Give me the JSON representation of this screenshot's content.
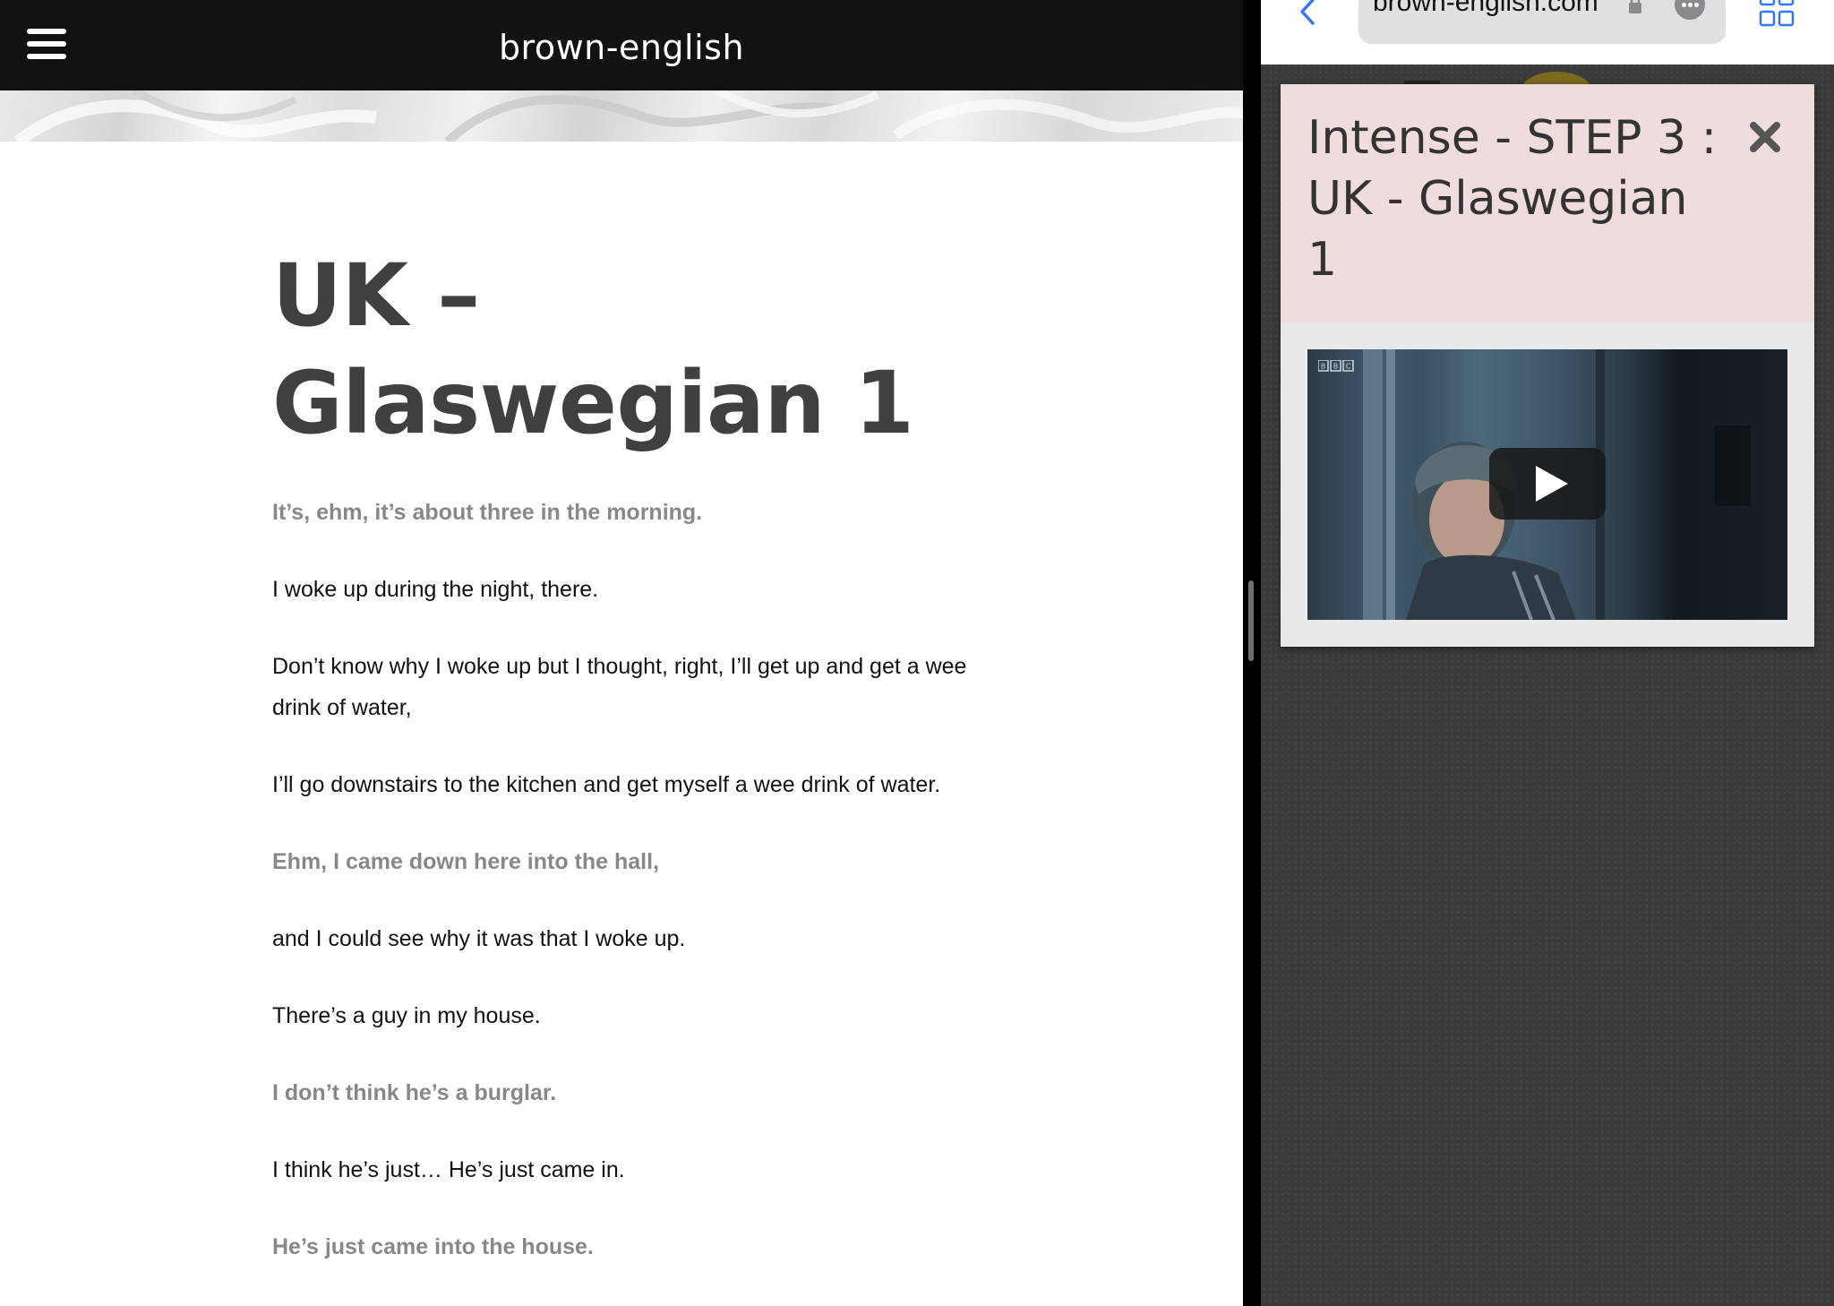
{
  "site": {
    "title": "brown-english"
  },
  "article": {
    "title": "UK – Glaswegian 1",
    "lines": [
      {
        "text": "It’s, ehm, it’s about three in the morning.",
        "style": "muted"
      },
      {
        "text": "I woke up during the night, there.",
        "style": "normal"
      },
      {
        "text": "Don’t know why I woke up but I thought, right, I’ll get up and get a wee drink of water,",
        "style": "normal"
      },
      {
        "text": "I’ll go downstairs to the kitchen and get myself a wee drink of water.",
        "style": "normal"
      },
      {
        "text": "Ehm, I came down here into the hall,",
        "style": "muted"
      },
      {
        "text": "and I could see why it was that I woke up.",
        "style": "normal"
      },
      {
        "text": "There’s a guy in my house.",
        "style": "normal"
      },
      {
        "text": "I don’t think he’s a burglar.",
        "style": "muted"
      },
      {
        "text": "I think he’s just… He’s just came in.",
        "style": "normal"
      },
      {
        "text": "He’s just came into the house.",
        "style": "muted"
      }
    ]
  },
  "browser": {
    "url": "brown-english.com",
    "icons": {
      "back": "chevron-left-icon",
      "lock": "lock-icon",
      "more": "ellipsis-icon",
      "tabs": "tabs-grid-icon"
    }
  },
  "modal": {
    "title": "Intense - STEP 3 : UK - Glaswegian 1",
    "video": {
      "badge": "BBC",
      "play_icon": "play-icon"
    },
    "close_icon": "close-icon"
  },
  "colors": {
    "header_bg": "#121212",
    "title_text": "#404040",
    "muted_text": "#888888",
    "modal_header_bg": "#f0dcdc",
    "ios_blue": "#3478f6"
  }
}
